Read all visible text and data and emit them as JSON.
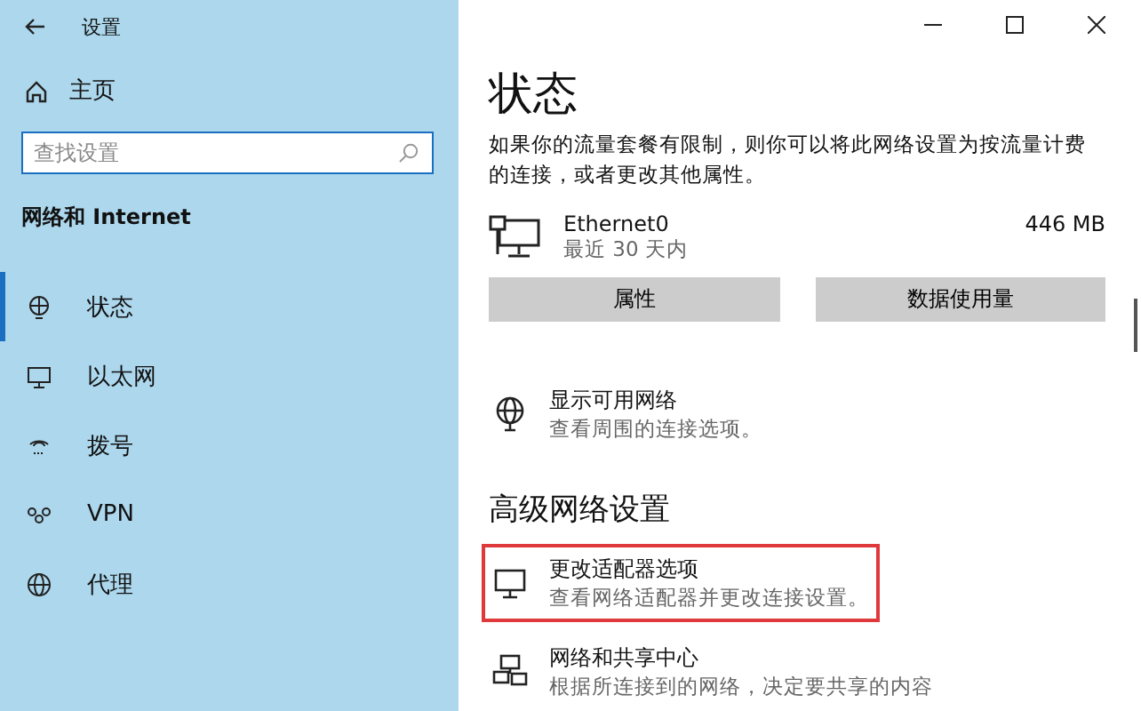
{
  "window": {
    "title": "设置"
  },
  "sidebar": {
    "home": "主页",
    "search": {
      "placeholder": "查找设置"
    },
    "section": "网络和 Internet",
    "items": [
      {
        "kind": "status",
        "label": "状态",
        "selected": true
      },
      {
        "kind": "ethernet",
        "label": "以太网",
        "selected": false
      },
      {
        "kind": "dialup",
        "label": "拨号",
        "selected": false
      },
      {
        "kind": "vpn",
        "label": "VPN",
        "selected": false
      },
      {
        "kind": "proxy",
        "label": "代理",
        "selected": false
      }
    ]
  },
  "main": {
    "title": "状态",
    "description": "如果你的流量套餐有限制，则你可以将此网络设置为按流量计费的连接，或者更改其他属性。",
    "connection": {
      "name": "Ethernet0",
      "period": "最近 30 天内",
      "usage": "446 MB"
    },
    "buttons": [
      "属性",
      "数据使用量"
    ],
    "links": [
      {
        "kind": "globe",
        "title": "显示可用网络",
        "subtitle": "查看周围的连接选项。",
        "highlighted": false
      }
    ],
    "advanced_heading": "高级网络设置",
    "advanced_links": [
      {
        "kind": "adapter",
        "title": "更改适配器选项",
        "subtitle": "查看网络适配器并更改连接设置。",
        "highlighted": true
      },
      {
        "kind": "sharing",
        "title": "网络和共享中心",
        "subtitle": "根据所连接到的网络，决定要共享的内容",
        "highlighted": false
      }
    ]
  }
}
